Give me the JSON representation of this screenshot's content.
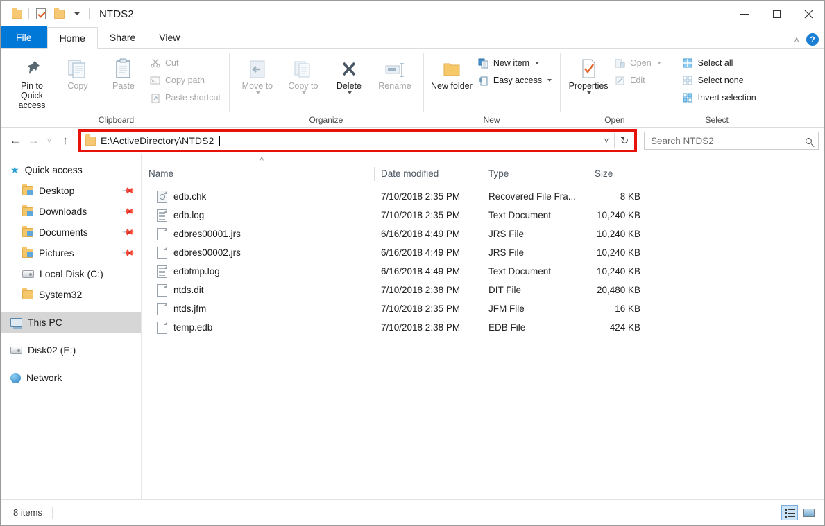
{
  "window": {
    "title": "NTDS2",
    "quick_access_icons": [
      "folder-icon",
      "checkbox-properties-icon",
      "folder-icon",
      "customize-caret-icon"
    ],
    "controls": {
      "minimize": "—",
      "maximize": "□",
      "close": "✕"
    }
  },
  "ribbon": {
    "tabs": [
      {
        "label": "File",
        "kind": "file"
      },
      {
        "label": "Home",
        "kind": "active"
      },
      {
        "label": "Share",
        "kind": "normal"
      },
      {
        "label": "View",
        "kind": "normal"
      }
    ],
    "collapse_icon": "˄",
    "help_icon": "?",
    "groups": [
      {
        "name": "Clipboard",
        "big": [
          {
            "label": "Pin to Quick access",
            "icon": "pin-icon",
            "disabled": false
          },
          {
            "label": "Copy",
            "icon": "copy-icon",
            "disabled": true
          },
          {
            "label": "Paste",
            "icon": "paste-icon",
            "disabled": true
          }
        ],
        "small": [
          {
            "label": "Cut",
            "icon": "scissors-icon",
            "disabled": true
          },
          {
            "label": "Copy path",
            "icon": "copy-path-icon",
            "disabled": true
          },
          {
            "label": "Paste shortcut",
            "icon": "paste-shortcut-icon",
            "disabled": true
          }
        ]
      },
      {
        "name": "Organize",
        "big": [
          {
            "label": "Move to",
            "icon": "move-to-icon",
            "disabled": true,
            "caret": true
          },
          {
            "label": "Copy to",
            "icon": "copy-to-icon",
            "disabled": true,
            "caret": true
          },
          {
            "label": "Delete",
            "icon": "delete-x-icon",
            "disabled": false,
            "caret": true
          },
          {
            "label": "Rename",
            "icon": "rename-icon",
            "disabled": true
          }
        ],
        "small": []
      },
      {
        "name": "New",
        "big": [
          {
            "label": "New folder",
            "icon": "new-folder-icon",
            "disabled": false
          }
        ],
        "small": [
          {
            "label": "New item",
            "icon": "new-item-icon",
            "disabled": false,
            "caret": true
          },
          {
            "label": "Easy access",
            "icon": "easy-access-icon",
            "disabled": false,
            "caret": true
          }
        ]
      },
      {
        "name": "Open",
        "big": [
          {
            "label": "Properties",
            "icon": "properties-icon",
            "disabled": false,
            "caret": true
          }
        ],
        "small": [
          {
            "label": "Open",
            "icon": "open-icon",
            "disabled": true,
            "caret": true
          },
          {
            "label": "Edit",
            "icon": "edit-pencil-icon",
            "disabled": true
          }
        ]
      },
      {
        "name": "Select",
        "big": [],
        "small": [
          {
            "label": "Select all",
            "icon": "select-all-icon",
            "disabled": false
          },
          {
            "label": "Select none",
            "icon": "select-none-icon",
            "disabled": false
          },
          {
            "label": "Invert selection",
            "icon": "invert-selection-icon",
            "disabled": false
          }
        ]
      }
    ]
  },
  "address_bar": {
    "back_icon": "←",
    "forward_icon": "→",
    "recent_icon": "˅",
    "up_icon": "↑",
    "path": "E:\\ActiveDirectory\\NTDS2",
    "dropdown_icon": "˅",
    "refresh_icon": "↻",
    "highlight_color": "#e8120c",
    "search_placeholder": "Search NTDS2"
  },
  "sidebar": {
    "items": [
      {
        "label": "Quick access",
        "icon": "star-icon",
        "level": 1,
        "pinned": false,
        "selected": false
      },
      {
        "label": "Desktop",
        "icon": "folder-desktop-icon",
        "level": 2,
        "pinned": true,
        "selected": false
      },
      {
        "label": "Downloads",
        "icon": "folder-downloads-icon",
        "level": 2,
        "pinned": true,
        "selected": false
      },
      {
        "label": "Documents",
        "icon": "folder-documents-icon",
        "level": 2,
        "pinned": true,
        "selected": false
      },
      {
        "label": "Pictures",
        "icon": "folder-pictures-icon",
        "level": 2,
        "pinned": true,
        "selected": false
      },
      {
        "label": "Local Disk (C:)",
        "icon": "disk-icon",
        "level": 2,
        "pinned": false,
        "selected": false
      },
      {
        "label": "System32",
        "icon": "folder-icon",
        "level": 2,
        "pinned": false,
        "selected": false
      },
      {
        "label": "This PC",
        "icon": "pc-icon",
        "level": 1,
        "pinned": false,
        "selected": true
      },
      {
        "label": "Disk02 (E:)",
        "icon": "disk-icon",
        "level": 1,
        "pinned": false,
        "selected": false
      },
      {
        "label": "Network",
        "icon": "network-globe-icon",
        "level": 1,
        "pinned": false,
        "selected": false
      }
    ]
  },
  "file_list": {
    "sort_indicator": "˄",
    "columns": [
      "Name",
      "Date modified",
      "Type",
      "Size"
    ],
    "rows": [
      {
        "name": "edb.chk",
        "date": "7/10/2018 2:35 PM",
        "type": "Recovered File Fra...",
        "size": "8 KB",
        "icon": "chk-file-icon"
      },
      {
        "name": "edb.log",
        "date": "7/10/2018 2:35 PM",
        "type": "Text Document",
        "size": "10,240 KB",
        "icon": "text-file-icon"
      },
      {
        "name": "edbres00001.jrs",
        "date": "6/16/2018 4:49 PM",
        "type": "JRS File",
        "size": "10,240 KB",
        "icon": "generic-file-icon"
      },
      {
        "name": "edbres00002.jrs",
        "date": "6/16/2018 4:49 PM",
        "type": "JRS File",
        "size": "10,240 KB",
        "icon": "generic-file-icon"
      },
      {
        "name": "edbtmp.log",
        "date": "6/16/2018 4:49 PM",
        "type": "Text Document",
        "size": "10,240 KB",
        "icon": "text-file-icon"
      },
      {
        "name": "ntds.dit",
        "date": "7/10/2018 2:38 PM",
        "type": "DIT File",
        "size": "20,480 KB",
        "icon": "generic-file-icon"
      },
      {
        "name": "ntds.jfm",
        "date": "7/10/2018 2:35 PM",
        "type": "JFM File",
        "size": "16 KB",
        "icon": "generic-file-icon"
      },
      {
        "name": "temp.edb",
        "date": "7/10/2018 2:38 PM",
        "type": "EDB File",
        "size": "424 KB",
        "icon": "generic-file-icon"
      }
    ]
  },
  "status_bar": {
    "item_count": "8 items",
    "views": [
      {
        "name": "details-view",
        "active": true
      },
      {
        "name": "large-icons-view",
        "active": false
      }
    ]
  }
}
